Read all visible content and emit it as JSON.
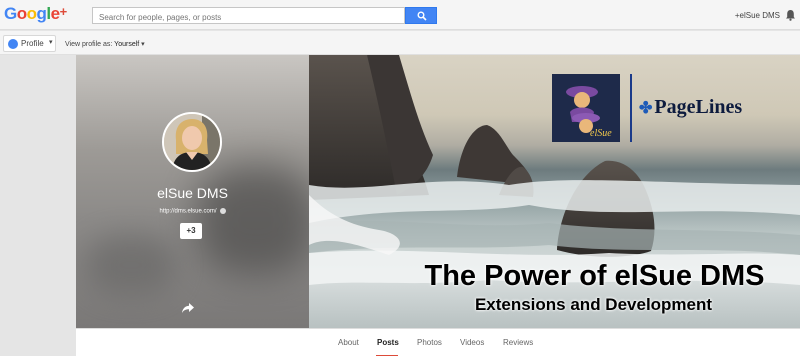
{
  "header": {
    "logo_text": "Google+",
    "search_placeholder": "Search for people, pages, or posts",
    "user_link": "+elSue DMS"
  },
  "subbar": {
    "profile_label": "Profile",
    "view_as_label": "View profile as:",
    "view_as_value": "Yourself"
  },
  "profile": {
    "name": "elSue DMS",
    "url": "http://dms.elsue.com/",
    "plus_count": "+3"
  },
  "cover": {
    "title": "The Power of elSue DMS",
    "subtitle": "Extensions and Development",
    "brand": "PageLines",
    "logo_caption": "elSue"
  },
  "tabs": [
    {
      "label": "About"
    },
    {
      "label": "Posts",
      "active": true
    },
    {
      "label": "Photos"
    },
    {
      "label": "Videos"
    },
    {
      "label": "Reviews"
    }
  ],
  "colors": {
    "accent_red": "#dd4b39",
    "google_blue": "#4285f4"
  }
}
